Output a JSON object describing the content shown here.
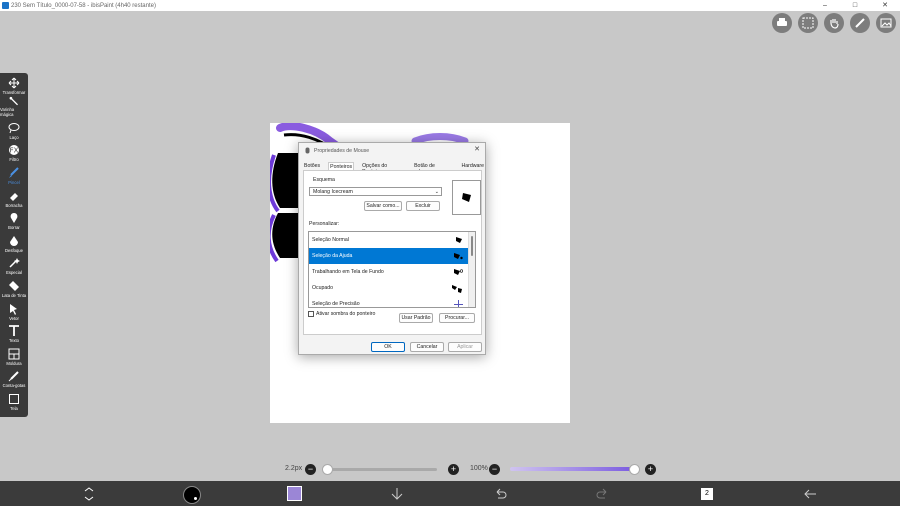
{
  "window": {
    "title": "230 Sem Título_0000-07-58 - ibisPaint (4h40 restante)",
    "minimize": "–",
    "maximize": "□",
    "close": "✕"
  },
  "toolbar": {
    "tools": [
      {
        "label": "Transformar",
        "icon": "transform-icon"
      },
      {
        "label": "Varinha mágica",
        "icon": "magic-wand-icon"
      },
      {
        "label": "Laço",
        "icon": "lasso-icon"
      },
      {
        "label": "Filtro",
        "icon": "filter-icon"
      },
      {
        "label": "Pincel",
        "icon": "brush-icon",
        "active": true
      },
      {
        "label": "Borracha",
        "icon": "eraser-icon"
      },
      {
        "label": "Borrar",
        "icon": "smudge-icon"
      },
      {
        "label": "Desfoque",
        "icon": "blur-icon"
      },
      {
        "label": "Especial",
        "icon": "special-icon"
      },
      {
        "label": "Lata de Tinta",
        "icon": "paint-bucket-icon"
      },
      {
        "label": "Vetor",
        "icon": "vector-icon"
      },
      {
        "label": "Texto",
        "icon": "text-icon"
      },
      {
        "label": "Moldura",
        "icon": "frame-icon"
      },
      {
        "label": "Conta-gotas",
        "icon": "eyedropper-icon"
      },
      {
        "label": "Tela",
        "icon": "canvas-icon"
      }
    ]
  },
  "dialog": {
    "title": "Propriedades de Mouse",
    "close": "✕",
    "tabs": [
      "Botões",
      "Ponteiros",
      "Opções do Ponteiro",
      "Botão de rolagem",
      "Hardware"
    ],
    "scheme_label": "Esquema",
    "scheme_value": "Molang Icecream",
    "save_as": "Salvar como...",
    "delete": "Excluir",
    "customize_label": "Personalizar:",
    "cursor_rows": [
      "Seleção Normal",
      "Seleção da Ajuda",
      "Trabalhando em Tela de Fundo",
      "Ocupado",
      "Seleção de Precisão"
    ],
    "shadow_checkbox": "Ativar sombra do ponteiro",
    "use_default": "Usar Padrão",
    "browse": "Procurar...",
    "ok": "OK",
    "cancel": "Cancelar",
    "apply": "Aplicar"
  },
  "sliders": {
    "brush_size": "2.2px",
    "brush_size_fraction": 0.0,
    "opacity": "100%",
    "opacity_fraction": 1.0
  },
  "layers_count": "2",
  "colors": {
    "accent": "#0078d4",
    "current_color": "#9b86d6",
    "stroke_purple": "#6d3ad8"
  }
}
